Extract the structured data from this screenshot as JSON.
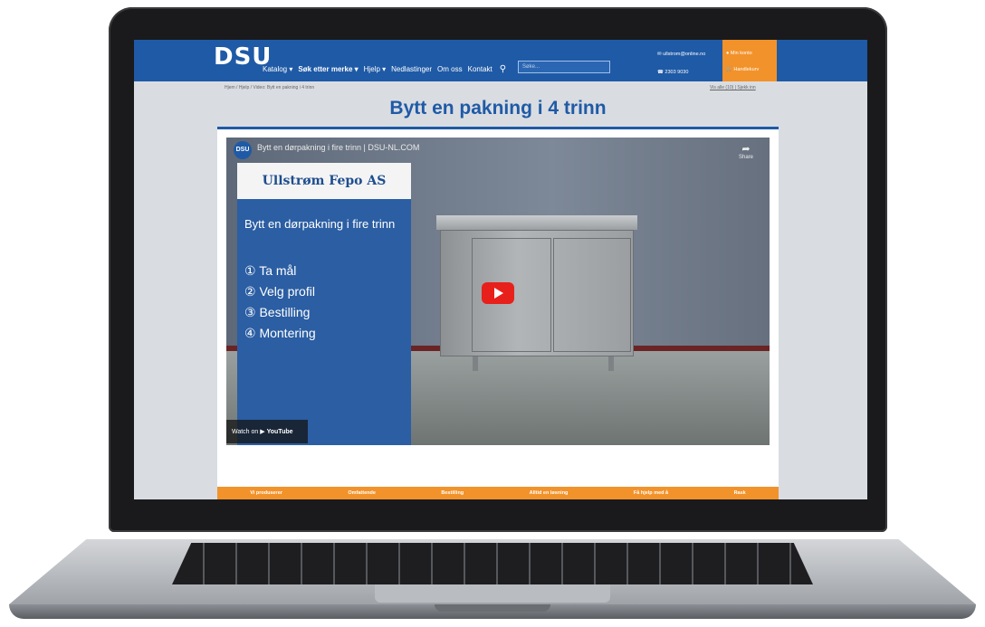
{
  "header": {
    "logo": "DSU",
    "nav": [
      "Katalog ▾",
      "Søk etter merke ▾",
      "Hjelp ▾",
      "Nedlastinger",
      "Om oss",
      "Kontakt"
    ],
    "search_placeholder": "Søke...",
    "email": "ullstrom@online.no",
    "phone": "2303 9030",
    "account": "Min konto",
    "cart": "Handlekurv"
  },
  "breadcrumb": "Hjem / Hjelp / Video: Bytt en pakning i 4 trinn",
  "toplinks": "Vis alle (10) | Sjekk inn",
  "page_title": "Bytt en pakning i 4 trinn",
  "video": {
    "title": "Bytt en dørpakning i fire trinn | DSU-NL.COM",
    "channel_badge": "DSU",
    "share": "Share",
    "overlay_company": "Ullstrøm Fepo AS",
    "overlay_subtitle": "Bytt en dørpakning i fire trinn",
    "steps": [
      "① Ta mål",
      "② Velg profil",
      "③ Bestilling",
      "④ Montering"
    ],
    "watch_on": "Watch on",
    "watch_brand": "YouTube"
  },
  "band": [
    "Vi produserer",
    "Omfattende",
    "Bestilling",
    "Alltid en løsning",
    "Få hjelp med å",
    "Rask"
  ]
}
